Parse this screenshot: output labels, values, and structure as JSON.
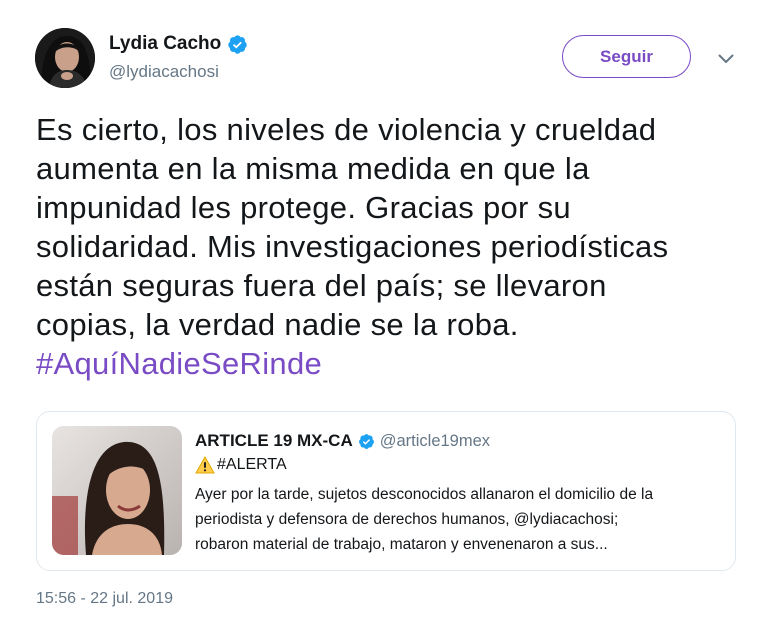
{
  "author": {
    "name": "Lydia Cacho",
    "handle": "@lydiacachosi"
  },
  "follow_button_label": "Seguir",
  "tweet": {
    "lines": [
      "Es cierto, los niveles de violencia y crueldad",
      "aumenta en la misma medida en que la",
      "impunidad les protege. Gracias por su",
      "solidaridad. Mis investigaciones periodísticas",
      "están seguras fuera del país; se llevaron",
      "copias, la verdad nadie se la roba."
    ],
    "hashtag": "#AquíNadieSeRinde"
  },
  "quoted_tweet": {
    "name": "ARTICLE 19 MX-CA",
    "handle": "@article19mex",
    "alert_text": "#ALERTA",
    "body_lines": [
      "Ayer por la tarde, sujetos desconocidos allanaron el domicilio de la",
      "periodista y defensora de derechos humanos, @lydiacachosi;",
      "robaron material de trabajo, mataron y envenenaron a sus..."
    ]
  },
  "timestamp": "15:56 - 22 jul. 2019",
  "icons": {
    "verified": "verified-badge-icon",
    "caret": "chevron-down-icon",
    "warning": "warning-icon"
  },
  "colors": {
    "accent": "#794bc4",
    "verified": "#1da1f2",
    "secondary_text": "#657786",
    "border": "#e1e8ed"
  }
}
